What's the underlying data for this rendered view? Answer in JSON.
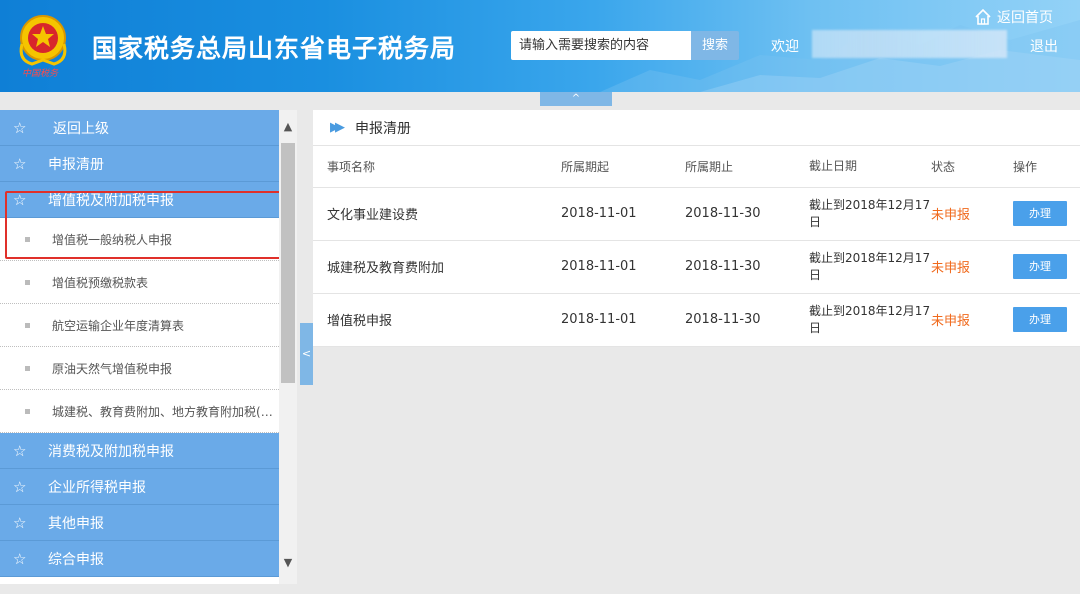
{
  "header": {
    "site_title": "国家税务总局山东省电子税务局",
    "search_placeholder": "请输入需要搜索的内容",
    "search_button": "搜索",
    "welcome": "欢迎",
    "home_link": "返回首页",
    "logout": "退出",
    "emblem_caption": "中国税务",
    "collapse_glyph": "^"
  },
  "sidebar": {
    "back": "返回上级",
    "menu": [
      {
        "type": "head",
        "label": "申报清册"
      },
      {
        "type": "head",
        "label": "增值税及附加税申报"
      },
      {
        "type": "sub",
        "label": "增值税一般纳税人申报"
      },
      {
        "type": "sub",
        "label": "增值税预缴税款表"
      },
      {
        "type": "sub",
        "label": "航空运输企业年度清算表"
      },
      {
        "type": "sub",
        "label": "原油天然气增值税申报"
      },
      {
        "type": "sub",
        "label": "城建税、教育费附加、地方教育附加税(费)申报"
      },
      {
        "type": "head",
        "label": "消费税及附加税申报"
      },
      {
        "type": "head",
        "label": "企业所得税申报"
      },
      {
        "type": "head",
        "label": "其他申报"
      },
      {
        "type": "head",
        "label": "综合申报"
      }
    ],
    "toggle_glyph": "<"
  },
  "content": {
    "title": "申报清册",
    "columns": [
      "事项名称",
      "所属期起",
      "所属期止",
      "截止日期",
      "状态",
      "操作"
    ],
    "rows": [
      {
        "name": "文化事业建设费",
        "start": "2018-11-01",
        "end": "2018-11-30",
        "due": "截止到2018年12月17日",
        "status": "未申报",
        "action": "办理"
      },
      {
        "name": "城建税及教育费附加",
        "start": "2018-11-01",
        "end": "2018-11-30",
        "due": "截止到2018年12月17日",
        "status": "未申报",
        "action": "办理"
      },
      {
        "name": "增值税申报",
        "start": "2018-11-01",
        "end": "2018-11-30",
        "due": "截止到2018年12月17日",
        "status": "未申报",
        "action": "办理"
      }
    ]
  },
  "colors": {
    "header_blue": "#1a8fe0",
    "menu_blue": "#6aaae8",
    "button_blue": "#4aa0ea",
    "status_orange": "#f06a1d",
    "highlight_red": "#e0302a"
  },
  "icons": {
    "home": "home-icon",
    "star": "star-icon",
    "emblem": "tax-emblem-icon"
  }
}
